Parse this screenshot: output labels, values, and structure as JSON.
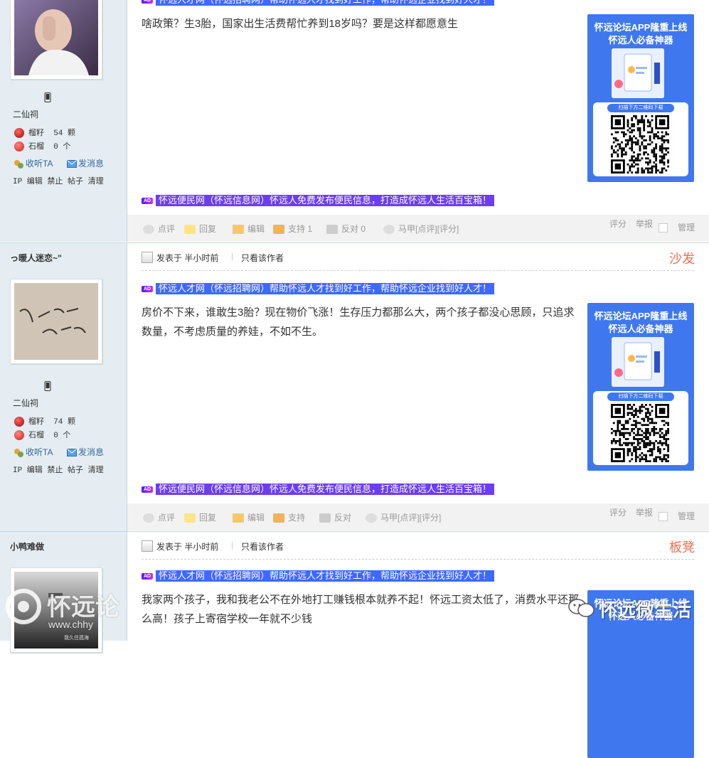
{
  "posts": [
    {
      "username": "",
      "level": "二仙祠",
      "stat_seeds_label": "榴籽",
      "stat_seeds_value": "54",
      "stat_seeds_unit": "颗",
      "stat_stone_label": "石榴",
      "stat_stone_value": "0",
      "stat_stone_unit": "个",
      "listen": "收听TA",
      "message": "发消息",
      "tools": "IP 编辑 禁止 帖子 清理",
      "body": "啥政策？生3胎，国家出生活费帮忙养到18岁吗？要是这样都愿意生",
      "ad_top": "怀远人才网（怀远招聘网）帮助怀远人才找到好工作，帮助怀远企业找到好人才！",
      "ad_bottom": "怀远便民网（怀远信息网）怀远人免费发布便民信息，打造成怀远人生活百宝箱！"
    },
    {
      "username": "っ暖人迷恋~\"",
      "level": "二仙祠",
      "stat_seeds_label": "榴籽",
      "stat_seeds_value": "74",
      "stat_seeds_unit": "颗",
      "stat_stone_label": "石榴",
      "stat_stone_value": "0",
      "stat_stone_unit": "个",
      "listen": "收听TA",
      "message": "发消息",
      "tools": "IP 编辑 禁止 帖子 清理",
      "posted": "发表于 半小时前",
      "only_author": "只看该作者",
      "floor": "沙发",
      "body": "房价不下来，谁敢生3胎？现在物价飞涨！生存压力都那么大，两个孩子都没心思顾，只追求数量，不考虑质量的养娃，不如不生。",
      "ad_top": "怀远人才网（怀远招聘网）帮助怀远人才找到好工作，帮助怀远企业找到好人才！",
      "ad_bottom": "怀远便民网（怀远信息网）怀远人免费发布便民信息，打造成怀远人生活百宝箱！"
    },
    {
      "username": "小鸭难做",
      "posted": "发表于 半小时前",
      "only_author": "只看该作者",
      "floor": "板凳",
      "body": "我家两个孩子，我和我老公不在外地打工赚钱根本就养不起！怀远工资太低了，消费水平还那么高！孩子上寄宿学校一年就不少钱",
      "ad_top": "怀远人才网（怀远招聘网）帮助怀远人才找到好工作，帮助怀远企业找到好人才！",
      "avatar_caption": "我久住孤海"
    }
  ],
  "promo": {
    "line1": "怀远论坛APP隆重上线",
    "line2": "怀远人必备神器",
    "scan": "扫描下方二维码下载"
  },
  "actions1": {
    "comment": "点评",
    "reply": "回复",
    "edit": "编辑",
    "support": "支持",
    "support_count": "1",
    "oppose": "反对",
    "oppose_count": "0",
    "horse": "马甲[点评][评分]",
    "rate": "评分",
    "report": "举报",
    "manage": "管理"
  },
  "actions2": {
    "comment": "点评",
    "reply": "回复",
    "edit": "编辑",
    "support": "支持",
    "oppose": "反对",
    "horse": "马甲[点评][评分]",
    "rate": "评分",
    "report": "举报",
    "manage": "管理"
  },
  "watermark": {
    "brand": "怀远论",
    "url": "www.chhy",
    "account": "怀远微生活"
  },
  "colors": {
    "sidebar": "#e5edf2",
    "floor": "#f26c4f",
    "ad_blue": "#3d69ff",
    "ad_purple": "#6b3df3",
    "link": "#336699"
  }
}
